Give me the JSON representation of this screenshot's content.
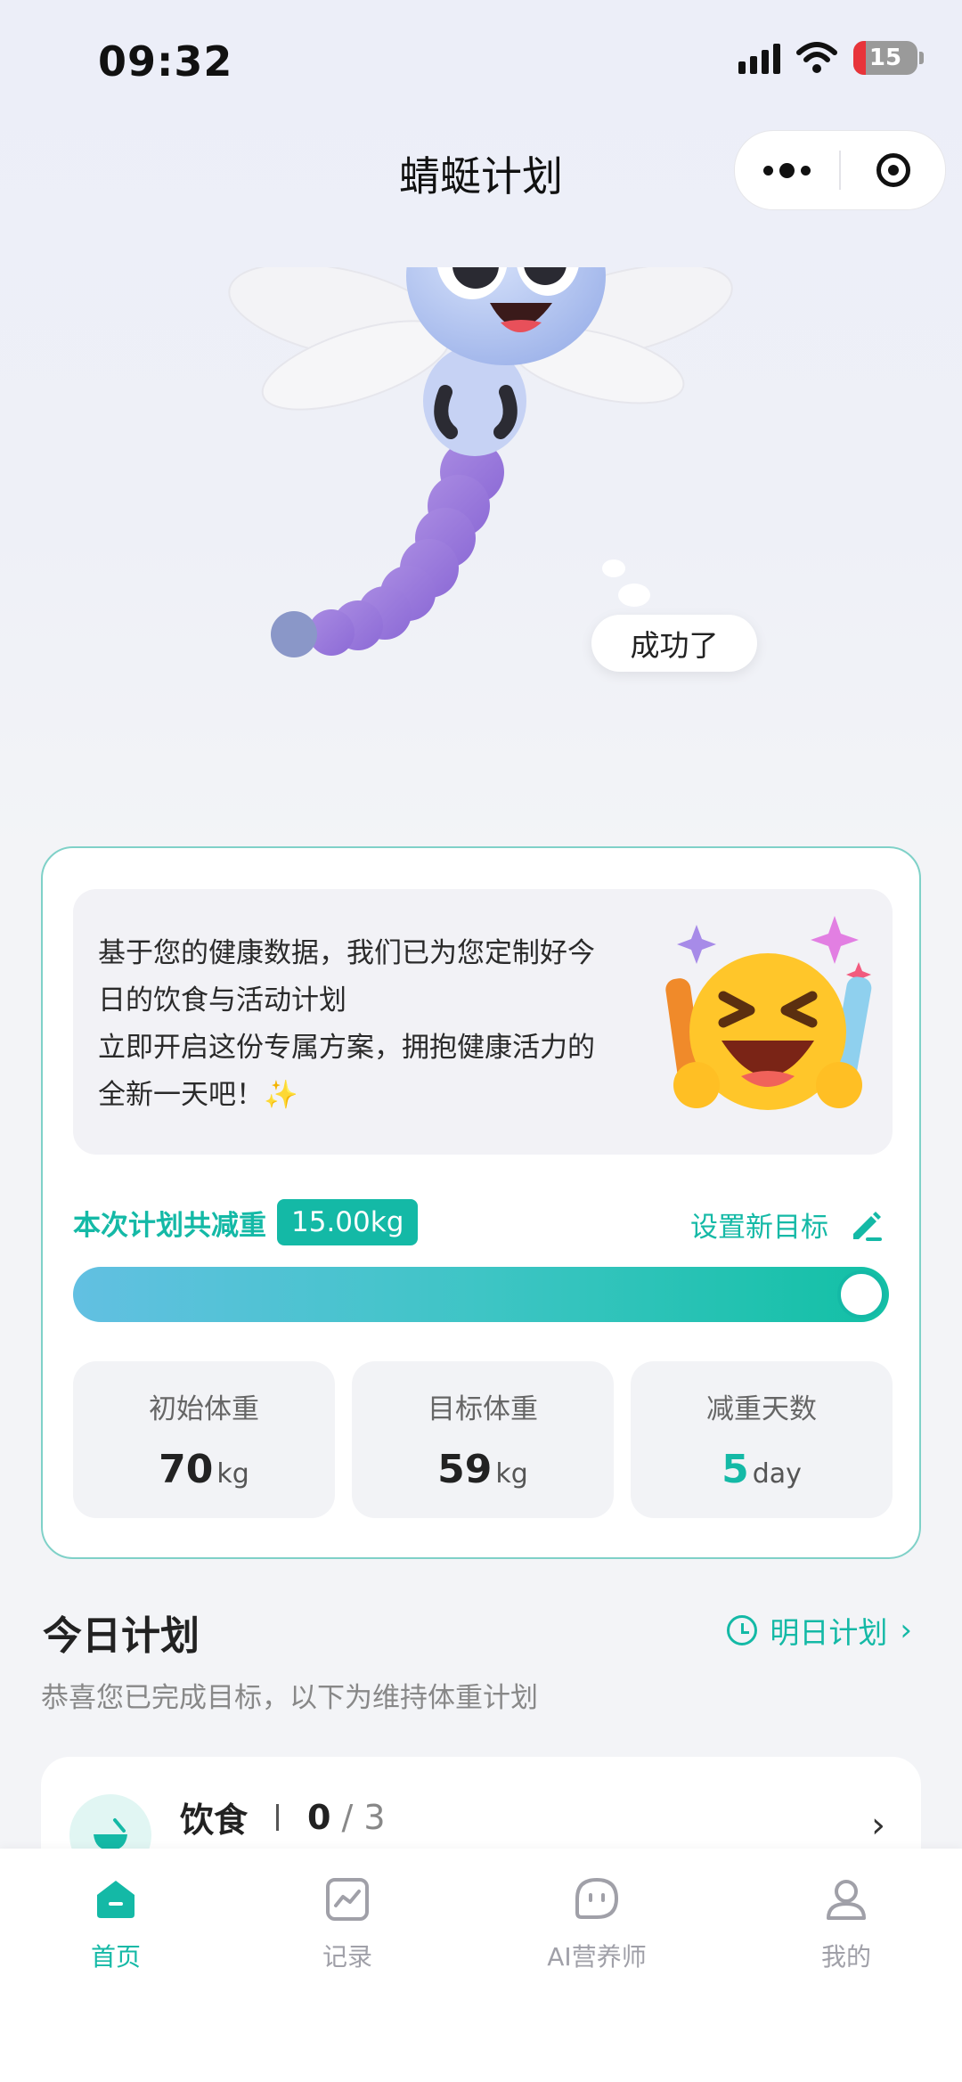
{
  "status_bar": {
    "time": "09:32",
    "battery": "15"
  },
  "header": {
    "title": "蜻蜓计划"
  },
  "mascot": {
    "speech": "成功了"
  },
  "plan_card": {
    "message_lines": [
      "基于您的健康数据，我们已为您定制好今",
      "日的饮食与活动计划",
      "立即开启这份专属方案，拥抱健康活力的",
      "全新一天吧！✨"
    ],
    "goal_label": "本次计划共减重",
    "goal_value": "15.00kg",
    "set_goal_label": "设置新目标",
    "progress_percent": 100,
    "stats": [
      {
        "label": "初始体重",
        "value": "70",
        "unit": "kg"
      },
      {
        "label": "目标体重",
        "value": "59",
        "unit": "kg"
      },
      {
        "label": "减重天数",
        "value": "5",
        "unit": "day"
      }
    ]
  },
  "today": {
    "title": "今日计划",
    "tomorrow_label": "明日计划",
    "subtitle": "恭喜您已完成目标，以下为维持体重计划",
    "diet": {
      "title": "饮食",
      "done": "0",
      "total": "/ 3"
    }
  },
  "tabbar": [
    {
      "label": "首页",
      "active": true
    },
    {
      "label": "记录",
      "active": false
    },
    {
      "label": "AI营养师",
      "active": false
    },
    {
      "label": "我的",
      "active": false
    }
  ],
  "colors": {
    "accent": "#14b9a6"
  }
}
